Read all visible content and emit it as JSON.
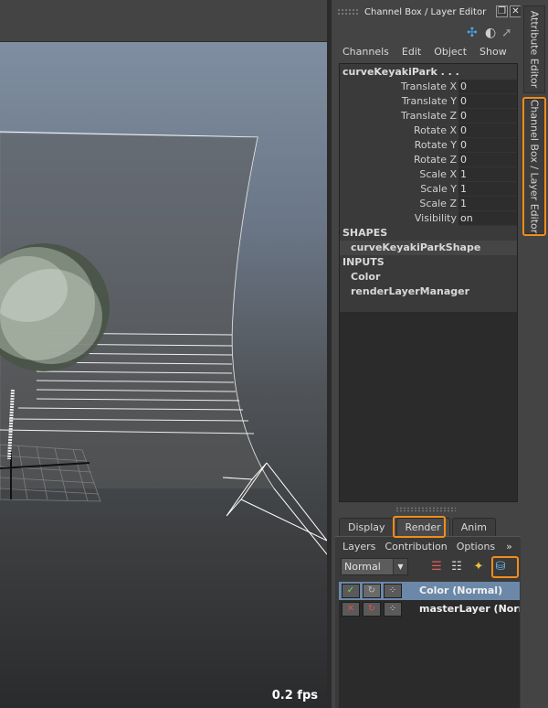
{
  "panel": {
    "title": "Channel Box / Layer Editor",
    "float_glyph": "❐",
    "close_glyph": "✕",
    "menu": [
      "Channels",
      "Edit",
      "Object",
      "Show"
    ]
  },
  "channel_box": {
    "node_name": "curveKeyakiPark . . .",
    "attributes": [
      {
        "label": "Translate X",
        "value": "0"
      },
      {
        "label": "Translate Y",
        "value": "0"
      },
      {
        "label": "Translate Z",
        "value": "0"
      },
      {
        "label": "Rotate X",
        "value": "0"
      },
      {
        "label": "Rotate Y",
        "value": "0"
      },
      {
        "label": "Rotate Z",
        "value": "0"
      },
      {
        "label": "Scale X",
        "value": "1"
      },
      {
        "label": "Scale Y",
        "value": "1"
      },
      {
        "label": "Scale Z",
        "value": "1"
      },
      {
        "label": "Visibility",
        "value": "on"
      }
    ],
    "shapes_header": "SHAPES",
    "shape_name": "curveKeyakiParkShape",
    "inputs_header": "INPUTS",
    "inputs": [
      "Color",
      "renderLayerManager"
    ]
  },
  "layer_editor": {
    "tabs": [
      "Display",
      "Render",
      "Anim"
    ],
    "active_tab": "Render",
    "menu": [
      "Layers",
      "Contribution",
      "Options"
    ],
    "menu_more": "»",
    "mode": "Normal",
    "layers": [
      {
        "name": "Color (Normal)",
        "selected": true
      },
      {
        "name": "masterLayer (Normal)",
        "selected": false
      }
    ]
  },
  "side_tabs": {
    "attribute_editor": "Attribute Editor",
    "channel_box": "Channel Box / Layer Editor"
  },
  "viewport": {
    "fps": "0.2 fps"
  },
  "colors": {
    "highlight": "#f28c1b",
    "selected_layer": "#6b88a8"
  },
  "icons": {
    "axis": "axis-gizmo-icon",
    "shading": "shading-ball-icon",
    "arrow": "arrow-tool-icon",
    "new_layer_objects": "new-layer-from-selected-icon",
    "new_layer": "new-empty-layer-icon",
    "new_layer_star": "new-layer-star-icon",
    "render_setup": "render-setup-icon"
  }
}
